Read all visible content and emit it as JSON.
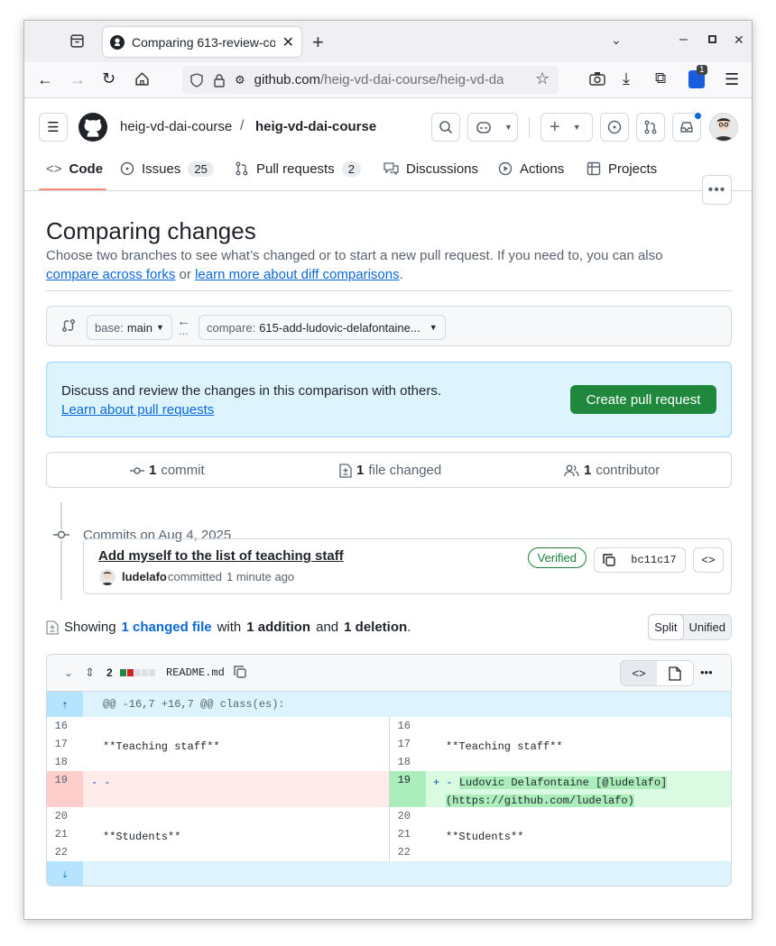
{
  "browser": {
    "tab_title": "Comparing 613-review-co",
    "url_host": "github.com",
    "url_path": "/heig-vd-dai-course/heig-vd-da",
    "extension_badge": "1"
  },
  "repo": {
    "owner": "heig-vd-dai-course",
    "separator": "/",
    "name": "heig-vd-dai-course"
  },
  "nav": {
    "code": "Code",
    "issues": "Issues",
    "issues_count": "25",
    "pulls": "Pull requests",
    "pulls_count": "2",
    "discussions": "Discussions",
    "actions": "Actions",
    "projects": "Projects"
  },
  "page": {
    "title": "Comparing changes",
    "subtitle": "Choose two branches to see what’s changed or to start a new pull request. If you need to, you can also ",
    "link_forks": "compare across forks",
    "or": " or ",
    "link_learn": "learn more about diff comparisons",
    "period": "."
  },
  "range": {
    "base_label": "base:",
    "base_value": "main",
    "compare_label": "compare:",
    "compare_value": "615-add-ludovic-delafontaine..."
  },
  "flash": {
    "text": "Discuss and review the changes in this comparison with others.",
    "link": "Learn about pull requests",
    "button": "Create pull request"
  },
  "summary": {
    "commits_n": "1",
    "commits_label": "commit",
    "files_n": "1",
    "files_label": "file changed",
    "contrib_n": "1",
    "contrib_label": "contributor"
  },
  "commits": {
    "date_header": "Commits on Aug 4, 2025",
    "message": "Add myself to the list of teaching staff",
    "author": "ludelafo",
    "action": "committed",
    "time": "1 minute ago",
    "verified": "Verified",
    "sha": "bc11c17"
  },
  "showing": {
    "prefix": "Showing",
    "changed": "1 changed file",
    "with": "with",
    "additions": "1 addition",
    "and": "and",
    "deletions": "1 deletion",
    "end": ".",
    "split": "Split",
    "unified": "Unified"
  },
  "diff": {
    "changes": "2",
    "filename": "README.md",
    "hunk": "@@ -16,7 +16,7 @@ class(es):",
    "left": [
      {
        "n": "16",
        "code": ""
      },
      {
        "n": "17",
        "code": "**Teaching staff**"
      },
      {
        "n": "18",
        "code": ""
      },
      {
        "n": "19",
        "code": "- -"
      },
      {
        "n": "20",
        "code": ""
      },
      {
        "n": "21",
        "code": "**Students**"
      },
      {
        "n": "22",
        "code": ""
      }
    ],
    "right": [
      {
        "n": "16",
        "code": ""
      },
      {
        "n": "17",
        "code": "**Teaching staff**"
      },
      {
        "n": "18",
        "code": ""
      },
      {
        "n": "19",
        "code_prefix": "+ - ",
        "code_l1": "Ludovic Delafontaine [@ludelafo]",
        "code_l2": "(https://github.com/ludelafo)"
      },
      {
        "n": "20",
        "code": ""
      },
      {
        "n": "21",
        "code": "**Students**"
      },
      {
        "n": "22",
        "code": ""
      }
    ]
  },
  "colors": {
    "accent": "#0969da",
    "primary_button": "#1f883d",
    "deletion_bg": "#ffebe9",
    "deletion_num_bg": "#ffcecb",
    "addition_bg": "#dafbe1",
    "addition_num_bg": "#aceebb"
  }
}
